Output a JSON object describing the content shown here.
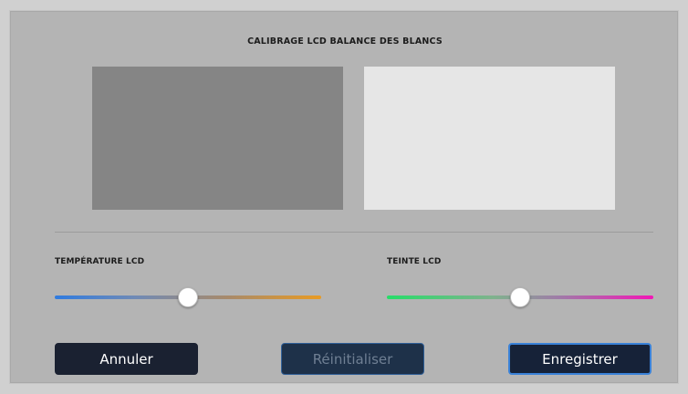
{
  "dialog": {
    "title": "CALIBRAGE LCD BALANCE DES BLANCS"
  },
  "swatches": {
    "left_color": "#858585",
    "right_color": "#e6e6e6"
  },
  "sliders": {
    "temperature": {
      "label": "TEMPÉRATURE LCD",
      "value_fraction": 0.5,
      "gradient_start": "#2f7be0",
      "gradient_end": "#e89b24"
    },
    "tint": {
      "label": "TEINTE LCD",
      "value_fraction": 0.5,
      "gradient_start": "#27dd69",
      "gradient_end": "#f217b6"
    }
  },
  "buttons": {
    "cancel_label": "Annuler",
    "reset_label": "Réinitialiser",
    "save_label": "Enregistrer"
  },
  "colors": {
    "dialog_bg": "#b4b4b4",
    "button_dark": "#1a2131",
    "accent_border": "#3a82d8"
  }
}
